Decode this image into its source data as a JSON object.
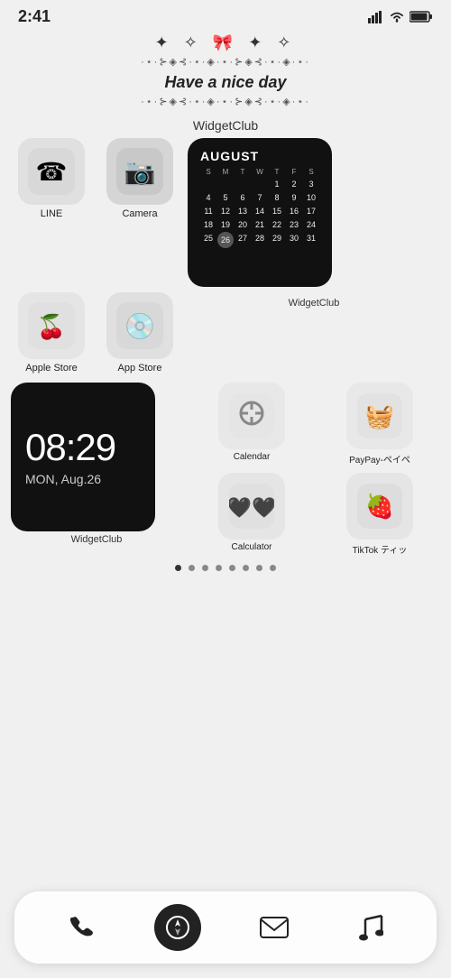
{
  "status": {
    "time": "2:41",
    "signal_bars": "▂▄▆█",
    "battery": "🔋"
  },
  "deco": {
    "bow_line": "✦ ✧ 🎀 ✦ ✧",
    "sparkle_line1": "·⋆·⊱◈⊰·⋆·◈·⋆·⊱◈⊰·⋆·◈·⋆·",
    "sparkle_line2": "·⋆·⊱◈⊰·⋆·◈·⋆·⊱◈⊰·⋆·◈·⋆·",
    "greeting": "Have a nice day",
    "widget_club": "WidgetClub"
  },
  "apps_row1": [
    {
      "name": "LINE",
      "icon": "line"
    },
    {
      "name": "Camera",
      "icon": "camera"
    }
  ],
  "calendar": {
    "month": "AUGUST",
    "headers": [
      "S",
      "M",
      "T",
      "W",
      "T",
      "F",
      "S"
    ],
    "days": [
      "",
      "",
      "",
      "",
      "1",
      "2",
      "3",
      "4",
      "5",
      "6",
      "7",
      "8",
      "9",
      "10",
      "11",
      "12",
      "13",
      "14",
      "15",
      "16",
      "17",
      "18",
      "19",
      "20",
      "21",
      "22",
      "23",
      "24",
      "25",
      "26",
      "27",
      "28",
      "29",
      "30",
      "31"
    ],
    "today": 26,
    "widget_label": "WidgetClub"
  },
  "apps_row2": [
    {
      "name": "Apple Store",
      "icon": "apple"
    },
    {
      "name": "App Store",
      "icon": "appstore"
    }
  ],
  "clock": {
    "time": "08:29",
    "date": "MON, Aug.26",
    "widget_label": "WidgetClub"
  },
  "right_apps": [
    {
      "name": "Calendar",
      "icon": "calendar"
    },
    {
      "name": "PayPay-ペイペ",
      "icon": "paypay"
    },
    {
      "name": "Calculator",
      "icon": "calculator"
    },
    {
      "name": "TikTok ティッ",
      "icon": "tiktok"
    }
  ],
  "page_dots": [
    true,
    false,
    false,
    false,
    false,
    false,
    false,
    false
  ],
  "dock": [
    {
      "name": "Phone",
      "icon": "phone"
    },
    {
      "name": "Safari",
      "icon": "compass"
    },
    {
      "name": "Mail",
      "icon": "mail"
    },
    {
      "name": "Music",
      "icon": "music"
    }
  ]
}
